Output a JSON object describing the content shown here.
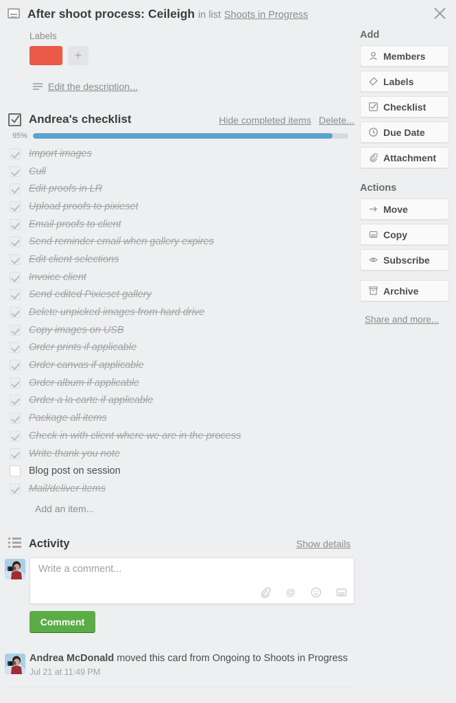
{
  "header": {
    "card_icon": "card-icon",
    "title": "After shoot process: Ceileigh",
    "in_list_text": "in list",
    "list_name": "Shoots in Progress",
    "close_icon": "close-icon"
  },
  "labels": {
    "heading": "Labels",
    "chips": [
      {
        "color": "#eb5a46"
      }
    ],
    "add_label": "+"
  },
  "description": {
    "edit_link": "Edit the description..."
  },
  "checklist": {
    "title": "Andrea's checklist",
    "hide_completed": "Hide completed items",
    "delete": "Delete...",
    "progress_percent": "95%",
    "progress_value": 95,
    "add_item": "Add an item...",
    "items": [
      {
        "text": "Import images",
        "checked": true
      },
      {
        "text": "Cull",
        "checked": true
      },
      {
        "text": "Edit proofs in LR",
        "checked": true
      },
      {
        "text": "Upload proofs to pixieset",
        "checked": true
      },
      {
        "text": "Email proofs to client",
        "checked": true
      },
      {
        "text": "Send reminder email when gallery expires",
        "checked": true
      },
      {
        "text": "Edit client selections",
        "checked": true
      },
      {
        "text": "Invoice client",
        "checked": true
      },
      {
        "text": "Send edited Pixieset gallery",
        "checked": true
      },
      {
        "text": "Delete unpicked images from hard drive",
        "checked": true
      },
      {
        "text": "Copy images on USB",
        "checked": true
      },
      {
        "text": "Order prints if applicable",
        "checked": true
      },
      {
        "text": "Order canvas if applicable",
        "checked": true
      },
      {
        "text": "Order album if applicable",
        "checked": true
      },
      {
        "text": "Order a la carte if applicable",
        "checked": true
      },
      {
        "text": "Package all items",
        "checked": true
      },
      {
        "text": "Check in with client where we are in the process",
        "checked": true
      },
      {
        "text": "Write thank you note",
        "checked": true
      },
      {
        "text": "Blog post on session",
        "checked": false
      },
      {
        "text": "Mail/deliver items",
        "checked": true
      }
    ]
  },
  "activity": {
    "title": "Activity",
    "show_details": "Show details",
    "comment_placeholder": "Write a comment...",
    "comment_button": "Comment",
    "tool_icons": [
      "attachment-icon",
      "mention-icon",
      "emoji-icon",
      "card-icon"
    ],
    "entries": [
      {
        "member": "Andrea McDonald",
        "action": " moved this card from Ongoing to Shoots in Progress",
        "time": "Jul 21 at 11:49 PM"
      }
    ]
  },
  "sidebar": {
    "add_heading": "Add",
    "add_buttons": [
      {
        "label": "Members",
        "icon": "member-icon"
      },
      {
        "label": "Labels",
        "icon": "label-icon"
      },
      {
        "label": "Checklist",
        "icon": "checklist-icon"
      },
      {
        "label": "Due Date",
        "icon": "clock-icon"
      },
      {
        "label": "Attachment",
        "icon": "attachment-icon"
      }
    ],
    "actions_heading": "Actions",
    "action_buttons": [
      {
        "label": "Move",
        "icon": "arrow-right-icon"
      },
      {
        "label": "Copy",
        "icon": "card-icon"
      },
      {
        "label": "Subscribe",
        "icon": "eye-icon"
      },
      {
        "label": "Archive",
        "icon": "archive-icon"
      }
    ],
    "share_more": "Share and more..."
  },
  "colors": {
    "label_red": "#eb5a46",
    "progress_blue": "#5ba4cf",
    "comment_green": "#5aac44",
    "background": "#edeff0"
  }
}
